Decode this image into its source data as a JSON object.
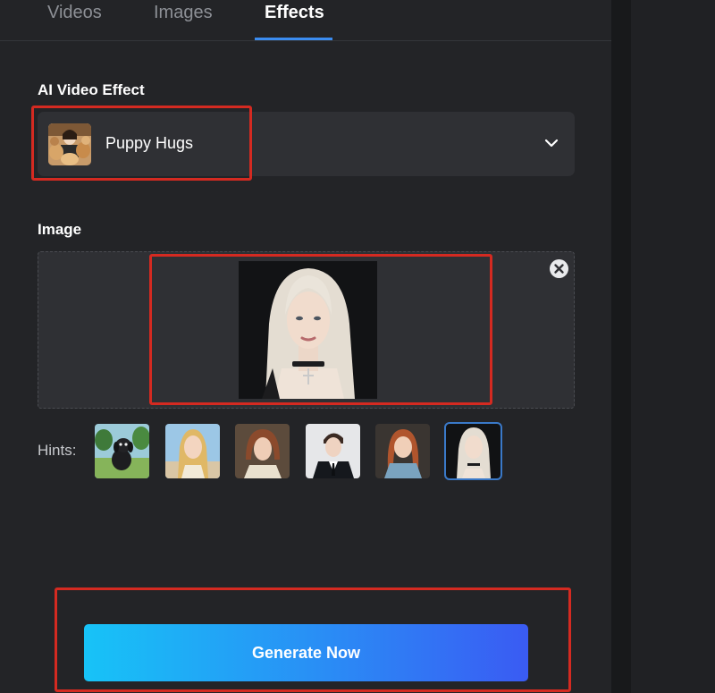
{
  "tabs": [
    {
      "label": "Videos",
      "active": false
    },
    {
      "label": "Images",
      "active": false
    },
    {
      "label": "Effects",
      "active": true
    }
  ],
  "effect": {
    "label": "AI Video Effect",
    "selected": "Puppy Hugs",
    "thumbnail_icon": "puppy-hugs-thumbnail",
    "dropdown_icon": "chevron-down-icon"
  },
  "image": {
    "label": "Image",
    "uploaded_icon": "portrait-platinum-blonde-woman",
    "remove_icon": "close-icon"
  },
  "hints": {
    "label": "Hints:",
    "items": [
      {
        "icon": "black-puppy-thumbnail",
        "selected": false
      },
      {
        "icon": "blonde-girl-thumbnail",
        "selected": false
      },
      {
        "icon": "auburn-woman-thumbnail",
        "selected": false
      },
      {
        "icon": "young-man-suit-thumbnail",
        "selected": false
      },
      {
        "icon": "red-haired-woman-thumbnail",
        "selected": false
      },
      {
        "icon": "blonde-woman-thumbnail",
        "selected": true
      }
    ]
  },
  "generate_label": "Generate Now",
  "colors": {
    "accent": "#3b8cf0",
    "highlight": "#d42a21",
    "button_start": "#17c3f7",
    "button_end": "#3a5bf3"
  }
}
